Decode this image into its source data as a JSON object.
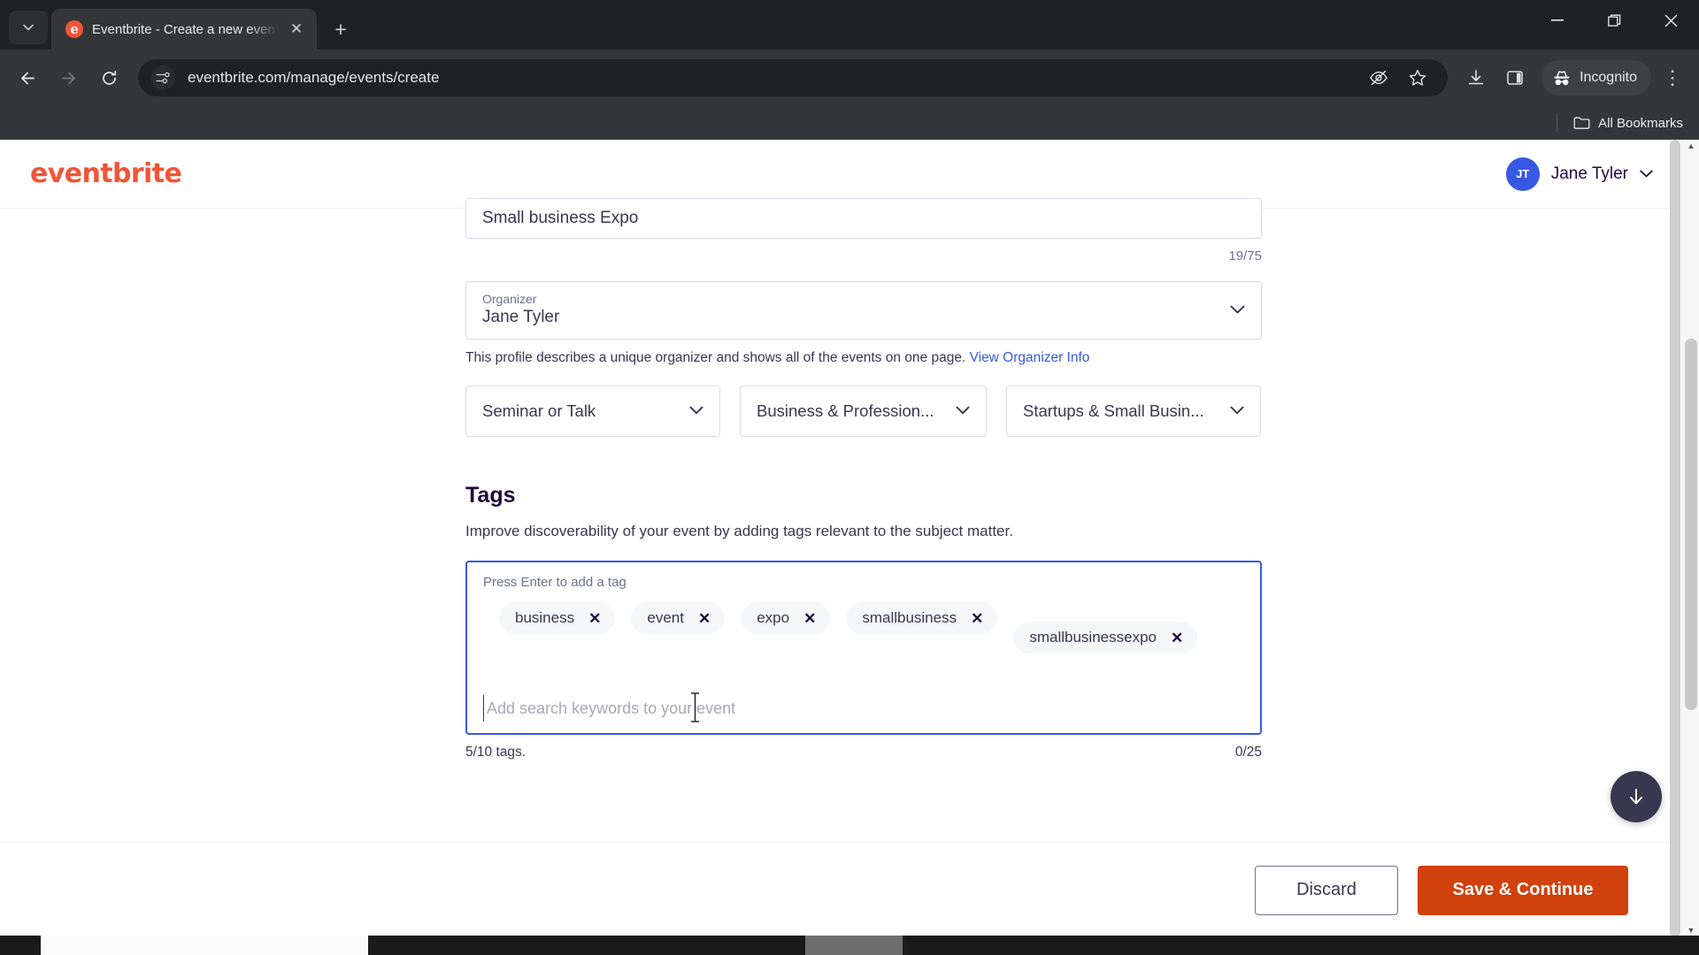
{
  "browser": {
    "tab": {
      "title": "Eventbrite - Create a new even",
      "favicon_letter": "e",
      "close_label": "✕"
    },
    "tablist_button": "⌄",
    "new_tab_label": "+",
    "window_controls": {
      "minimize": "—",
      "maximize": "❐",
      "close": "✕"
    },
    "nav": {
      "back": "←",
      "forward": "→",
      "reload": "↻"
    },
    "omnibox": {
      "url": "eventbrite.com/manage/events/create",
      "site_info_icon": "tune-icon"
    },
    "toolbar_right": {
      "tracking_protection": "eye-off-icon",
      "bookmark": "star-icon",
      "downloads": "download-icon",
      "side_panel": "side-panel-icon",
      "incognito_label": "Incognito",
      "menu": "⋮"
    },
    "bookmarks_bar": {
      "all_bookmarks_label": "All Bookmarks"
    }
  },
  "site_header": {
    "logo_text": "eventbrite",
    "user_initials": "JT",
    "user_name": "Jane Tyler",
    "user_caret": "⌄"
  },
  "form": {
    "event_title": {
      "value": "Small business Expo",
      "counter": "19/75"
    },
    "organizer": {
      "label": "Organizer",
      "value": "Jane Tyler",
      "caret": "⌄"
    },
    "organizer_helper": {
      "text": "This profile describes a unique organizer and shows all of the events on one page.",
      "link_text": "View Organizer Info"
    },
    "selects": [
      {
        "value": "Seminar or Talk",
        "caret": "⌄"
      },
      {
        "value": "Business & Profession...",
        "caret": "⌄"
      },
      {
        "value": "Startups & Small Busin...",
        "caret": "⌄"
      }
    ]
  },
  "tags_section": {
    "title": "Tags",
    "description": "Improve discoverability of your event by adding tags relevant to the subject matter.",
    "hint": "Press Enter to add a tag",
    "tags": [
      {
        "label": "business",
        "remove": "✕"
      },
      {
        "label": "event",
        "remove": "✕"
      },
      {
        "label": "expo",
        "remove": "✕"
      },
      {
        "label": "smallbusiness",
        "remove": "✕"
      },
      {
        "label": "smallbusinessexpo",
        "remove": "✕"
      }
    ],
    "input_value": "",
    "input_placeholder": "Add search keywords to your event",
    "tag_count": "5/10 tags.",
    "char_count": "0/25"
  },
  "footer": {
    "discard_label": "Discard",
    "save_label": "Save & Continue"
  },
  "scroll_fab": {
    "icon": "arrow-down-icon"
  },
  "colors": {
    "brand_orange": "#f05537",
    "cta_orange": "#d1410c",
    "accent_blue": "#3659e3",
    "text_dark": "#39364f",
    "text_heading": "#1e0a3c",
    "text_muted": "#6f7287"
  }
}
